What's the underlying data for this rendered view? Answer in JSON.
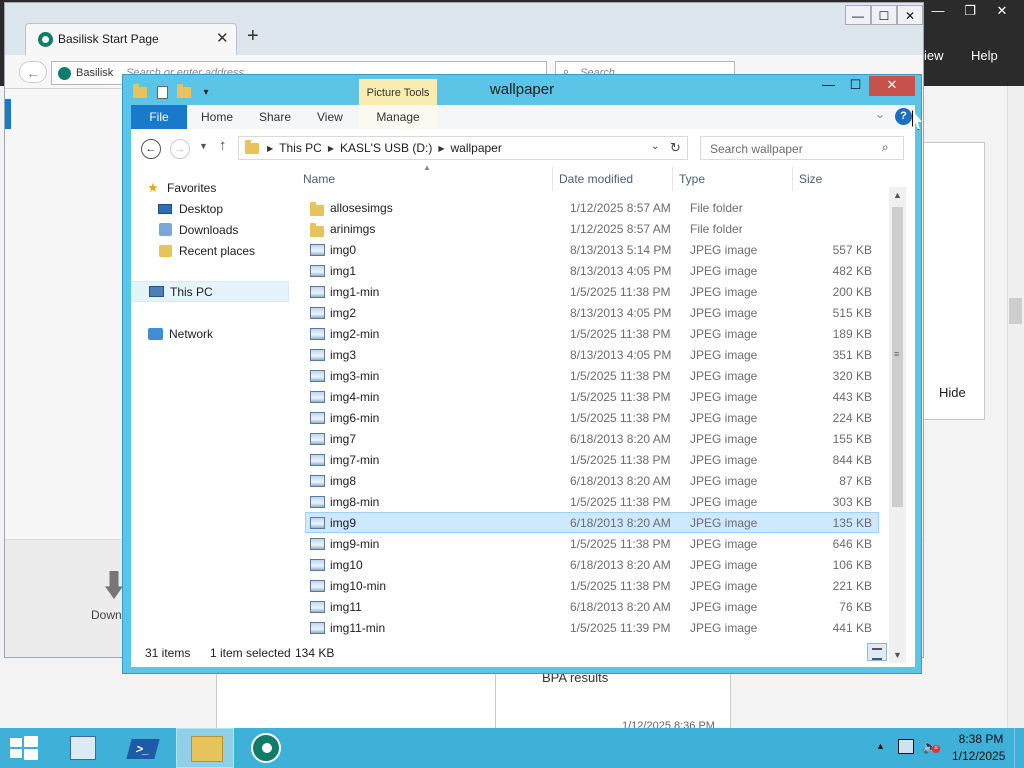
{
  "background_app": {
    "menu_view": "iew",
    "menu_help": "Help",
    "hide_label": "Hide",
    "bpa_label": "BPA results",
    "card_date": "1/12/2025 8:36 PM",
    "window_controls": [
      "—",
      "❐",
      "✕"
    ]
  },
  "browser": {
    "tab_title": "Basilisk Start Page",
    "tab_close": "✕",
    "new_tab": "+",
    "window_controls": [
      "—",
      "☐",
      "✕"
    ],
    "back": "←",
    "site_label": "Basilisk",
    "url_placeholder": "Search or enter address",
    "reload": "↻",
    "search_placeholder": "Search",
    "download_label": "Downl"
  },
  "explorer": {
    "title": "wallpaper",
    "picture_tools": "Picture Tools",
    "window_controls": {
      "min": "—",
      "max": "☐",
      "close": "✕"
    },
    "ribbon_tabs": {
      "file": "File",
      "home": "Home",
      "share": "Share",
      "view": "View",
      "manage": "Manage"
    },
    "help": "?",
    "breadcrumbs": [
      "This PC",
      "KASL'S USB (D:)",
      "wallpaper"
    ],
    "search_placeholder": "Search wallpaper",
    "nav": {
      "favorites": "Favorites",
      "desktop": "Desktop",
      "downloads": "Downloads",
      "recent_places": "Recent places",
      "this_pc": "This PC",
      "network": "Network"
    },
    "columns": {
      "name": "Name",
      "date": "Date modified",
      "type": "Type",
      "size": "Size"
    },
    "files": [
      {
        "name": "allosesimgs",
        "date": "1/12/2025 8:57 AM",
        "type": "File folder",
        "size": "",
        "kind": "folder"
      },
      {
        "name": "arinimgs",
        "date": "1/12/2025 8:57 AM",
        "type": "File folder",
        "size": "",
        "kind": "folder"
      },
      {
        "name": "img0",
        "date": "8/13/2013 5:14 PM",
        "type": "JPEG image",
        "size": "557 KB",
        "kind": "image"
      },
      {
        "name": "img1",
        "date": "8/13/2013 4:05 PM",
        "type": "JPEG image",
        "size": "482 KB",
        "kind": "image"
      },
      {
        "name": "img1-min",
        "date": "1/5/2025 11:38 PM",
        "type": "JPEG image",
        "size": "200 KB",
        "kind": "image"
      },
      {
        "name": "img2",
        "date": "8/13/2013 4:05 PM",
        "type": "JPEG image",
        "size": "515 KB",
        "kind": "image"
      },
      {
        "name": "img2-min",
        "date": "1/5/2025 11:38 PM",
        "type": "JPEG image",
        "size": "189 KB",
        "kind": "image"
      },
      {
        "name": "img3",
        "date": "8/13/2013 4:05 PM",
        "type": "JPEG image",
        "size": "351 KB",
        "kind": "image"
      },
      {
        "name": "img3-min",
        "date": "1/5/2025 11:38 PM",
        "type": "JPEG image",
        "size": "320 KB",
        "kind": "image"
      },
      {
        "name": "img4-min",
        "date": "1/5/2025 11:38 PM",
        "type": "JPEG image",
        "size": "443 KB",
        "kind": "image"
      },
      {
        "name": "img6-min",
        "date": "1/5/2025 11:38 PM",
        "type": "JPEG image",
        "size": "224 KB",
        "kind": "image"
      },
      {
        "name": "img7",
        "date": "6/18/2013 8:20 AM",
        "type": "JPEG image",
        "size": "155 KB",
        "kind": "image"
      },
      {
        "name": "img7-min",
        "date": "1/5/2025 11:38 PM",
        "type": "JPEG image",
        "size": "844 KB",
        "kind": "image"
      },
      {
        "name": "img8",
        "date": "6/18/2013 8:20 AM",
        "type": "JPEG image",
        "size": "87 KB",
        "kind": "image"
      },
      {
        "name": "img8-min",
        "date": "1/5/2025 11:38 PM",
        "type": "JPEG image",
        "size": "303 KB",
        "kind": "image"
      },
      {
        "name": "img9",
        "date": "6/18/2013 8:20 AM",
        "type": "JPEG image",
        "size": "135 KB",
        "kind": "image",
        "selected": true
      },
      {
        "name": "img9-min",
        "date": "1/5/2025 11:38 PM",
        "type": "JPEG image",
        "size": "646 KB",
        "kind": "image"
      },
      {
        "name": "img10",
        "date": "6/18/2013 8:20 AM",
        "type": "JPEG image",
        "size": "106 KB",
        "kind": "image"
      },
      {
        "name": "img10-min",
        "date": "1/5/2025 11:38 PM",
        "type": "JPEG image",
        "size": "221 KB",
        "kind": "image"
      },
      {
        "name": "img11",
        "date": "6/18/2013 8:20 AM",
        "type": "JPEG image",
        "size": "76 KB",
        "kind": "image"
      },
      {
        "name": "img11-min",
        "date": "1/5/2025 11:39 PM",
        "type": "JPEG image",
        "size": "441 KB",
        "kind": "image"
      }
    ],
    "status": {
      "count": "31 items",
      "selected": "1 item selected",
      "size": "134 KB"
    }
  },
  "taskbar": {
    "time": "8:38 PM",
    "date": "1/12/2025",
    "powershell_glyph": ">_"
  },
  "colors": {
    "explorer_frame": "#5cc4e6",
    "file_tab": "#1979ca",
    "close_button": "#c7524b",
    "selection": "#cde8ff",
    "taskbar": "#3fb0d7"
  }
}
